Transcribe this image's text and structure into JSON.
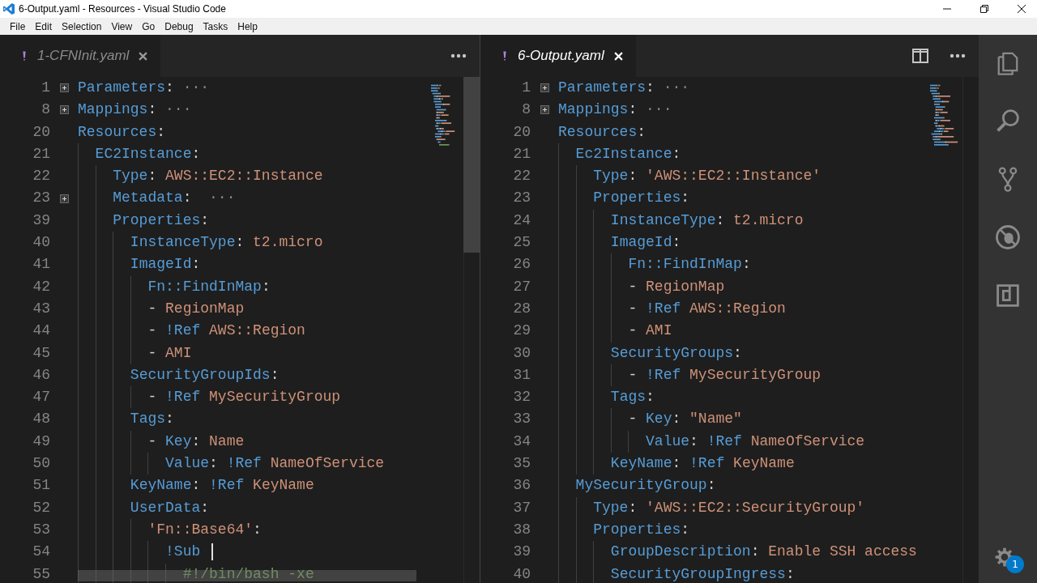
{
  "window": {
    "title": "6-Output.yaml - Resources - Visual Studio Code"
  },
  "menu": [
    "File",
    "Edit",
    "Selection",
    "View",
    "Go",
    "Debug",
    "Tasks",
    "Help"
  ],
  "editor_groups": [
    {
      "focused": false,
      "tab": {
        "label": "1-CFNInit.yaml"
      },
      "lines": [
        {
          "num": "1",
          "folded": true,
          "tokens": [
            {
              "t": "Parameters",
              "kind": "key"
            },
            {
              "t": ":",
              "kind": "punct"
            },
            {
              "t": " ···",
              "kind": "dots"
            }
          ]
        },
        {
          "num": "8",
          "folded": true,
          "tokens": [
            {
              "t": "Mappings",
              "kind": "key"
            },
            {
              "t": ":",
              "kind": "punct"
            },
            {
              "t": " ···",
              "kind": "dots"
            }
          ]
        },
        {
          "num": "20",
          "tokens": [
            {
              "t": "Resources",
              "kind": "key"
            },
            {
              "t": ":",
              "kind": "punct"
            }
          ]
        },
        {
          "num": "21",
          "tokens": [
            {
              "t": "  EC2Instance",
              "kind": "key"
            },
            {
              "t": ":",
              "kind": "punct"
            }
          ]
        },
        {
          "num": "22",
          "tokens": [
            {
              "t": "    Type",
              "kind": "key"
            },
            {
              "t": ": ",
              "kind": "punct"
            },
            {
              "t": "AWS::EC2::Instance",
              "kind": "str"
            }
          ]
        },
        {
          "num": "23",
          "folded": true,
          "tokens": [
            {
              "t": "    Metadata",
              "kind": "key"
            },
            {
              "t": ": ",
              "kind": "punct"
            },
            {
              "t": " ···",
              "kind": "dots"
            }
          ]
        },
        {
          "num": "39",
          "tokens": [
            {
              "t": "    Properties",
              "kind": "key"
            },
            {
              "t": ":",
              "kind": "punct"
            }
          ]
        },
        {
          "num": "40",
          "tokens": [
            {
              "t": "      InstanceType",
              "kind": "key"
            },
            {
              "t": ": ",
              "kind": "punct"
            },
            {
              "t": "t2.micro",
              "kind": "str"
            }
          ]
        },
        {
          "num": "41",
          "tokens": [
            {
              "t": "      ImageId",
              "kind": "key"
            },
            {
              "t": ":",
              "kind": "punct"
            }
          ]
        },
        {
          "num": "42",
          "tokens": [
            {
              "t": "        Fn::FindInMap",
              "kind": "key"
            },
            {
              "t": ":",
              "kind": "punct"
            }
          ]
        },
        {
          "num": "43",
          "tokens": [
            {
              "t": "        - ",
              "kind": "punct"
            },
            {
              "t": "RegionMap",
              "kind": "str"
            }
          ]
        },
        {
          "num": "44",
          "tokens": [
            {
              "t": "        - ",
              "kind": "punct"
            },
            {
              "t": "!Ref",
              "kind": "tag"
            },
            {
              "t": " AWS::Region",
              "kind": "str"
            }
          ]
        },
        {
          "num": "45",
          "tokens": [
            {
              "t": "        - ",
              "kind": "punct"
            },
            {
              "t": "AMI",
              "kind": "str"
            }
          ]
        },
        {
          "num": "46",
          "tokens": [
            {
              "t": "      SecurityGroupIds",
              "kind": "key"
            },
            {
              "t": ":",
              "kind": "punct"
            }
          ]
        },
        {
          "num": "47",
          "tokens": [
            {
              "t": "        - ",
              "kind": "punct"
            },
            {
              "t": "!Ref",
              "kind": "tag"
            },
            {
              "t": " MySecurityGroup",
              "kind": "str"
            }
          ]
        },
        {
          "num": "48",
          "tokens": [
            {
              "t": "      Tags",
              "kind": "key"
            },
            {
              "t": ":",
              "kind": "punct"
            }
          ]
        },
        {
          "num": "49",
          "tokens": [
            {
              "t": "        - ",
              "kind": "punct"
            },
            {
              "t": "Key",
              "kind": "key"
            },
            {
              "t": ": ",
              "kind": "punct"
            },
            {
              "t": "Name",
              "kind": "str"
            }
          ]
        },
        {
          "num": "50",
          "tokens": [
            {
              "t": "          Value",
              "kind": "key"
            },
            {
              "t": ": ",
              "kind": "punct"
            },
            {
              "t": "!Ref",
              "kind": "tag"
            },
            {
              "t": " NameOfService",
              "kind": "str"
            }
          ]
        },
        {
          "num": "51",
          "tokens": [
            {
              "t": "      KeyName",
              "kind": "key"
            },
            {
              "t": ": ",
              "kind": "punct"
            },
            {
              "t": "!Ref",
              "kind": "tag"
            },
            {
              "t": " KeyName",
              "kind": "str"
            }
          ]
        },
        {
          "num": "52",
          "tokens": [
            {
              "t": "      UserData",
              "kind": "key"
            },
            {
              "t": ":",
              "kind": "punct"
            }
          ]
        },
        {
          "num": "53",
          "tokens": [
            {
              "t": "        'Fn::Base64'",
              "kind": "str"
            },
            {
              "t": ":",
              "kind": "punct"
            }
          ]
        },
        {
          "num": "54",
          "cursor": true,
          "tokens": [
            {
              "t": "          !Sub",
              "kind": "tag"
            }
          ]
        },
        {
          "num": "55",
          "tokens": [
            {
              "t": "            #!/bin/bash -xe",
              "kind": "comment"
            }
          ]
        }
      ]
    },
    {
      "focused": true,
      "tab": {
        "label": "6-Output.yaml"
      },
      "lines": [
        {
          "num": "1",
          "folded": true,
          "tokens": [
            {
              "t": "Parameters",
              "kind": "key"
            },
            {
              "t": ":",
              "kind": "punct"
            },
            {
              "t": " ···",
              "kind": "dots"
            }
          ]
        },
        {
          "num": "8",
          "folded": true,
          "tokens": [
            {
              "t": "Mappings",
              "kind": "key"
            },
            {
              "t": ":",
              "kind": "punct"
            },
            {
              "t": " ···",
              "kind": "dots"
            }
          ]
        },
        {
          "num": "20",
          "tokens": [
            {
              "t": "Resources",
              "kind": "key"
            },
            {
              "t": ":",
              "kind": "punct"
            }
          ]
        },
        {
          "num": "21",
          "tokens": [
            {
              "t": "  Ec2Instance",
              "kind": "key"
            },
            {
              "t": ":",
              "kind": "punct"
            }
          ]
        },
        {
          "num": "22",
          "tokens": [
            {
              "t": "    Type",
              "kind": "key"
            },
            {
              "t": ": ",
              "kind": "punct"
            },
            {
              "t": "'AWS::EC2::Instance'",
              "kind": "str"
            }
          ]
        },
        {
          "num": "23",
          "tokens": [
            {
              "t": "    Properties",
              "kind": "key"
            },
            {
              "t": ":",
              "kind": "punct"
            }
          ]
        },
        {
          "num": "24",
          "tokens": [
            {
              "t": "      InstanceType",
              "kind": "key"
            },
            {
              "t": ": ",
              "kind": "punct"
            },
            {
              "t": "t2.micro",
              "kind": "str"
            }
          ]
        },
        {
          "num": "25",
          "tokens": [
            {
              "t": "      ImageId",
              "kind": "key"
            },
            {
              "t": ":",
              "kind": "punct"
            }
          ]
        },
        {
          "num": "26",
          "tokens": [
            {
              "t": "        Fn::FindInMap",
              "kind": "key"
            },
            {
              "t": ":",
              "kind": "punct"
            }
          ]
        },
        {
          "num": "27",
          "tokens": [
            {
              "t": "        - ",
              "kind": "punct"
            },
            {
              "t": "RegionMap",
              "kind": "str"
            }
          ]
        },
        {
          "num": "28",
          "tokens": [
            {
              "t": "        - ",
              "kind": "punct"
            },
            {
              "t": "!Ref",
              "kind": "tag"
            },
            {
              "t": " AWS::Region",
              "kind": "str"
            }
          ]
        },
        {
          "num": "29",
          "tokens": [
            {
              "t": "        - ",
              "kind": "punct"
            },
            {
              "t": "AMI",
              "kind": "str"
            }
          ]
        },
        {
          "num": "30",
          "tokens": [
            {
              "t": "      SecurityGroups",
              "kind": "key"
            },
            {
              "t": ":",
              "kind": "punct"
            }
          ]
        },
        {
          "num": "31",
          "tokens": [
            {
              "t": "        - ",
              "kind": "punct"
            },
            {
              "t": "!Ref",
              "kind": "tag"
            },
            {
              "t": " MySecurityGroup",
              "kind": "str"
            }
          ]
        },
        {
          "num": "32",
          "tokens": [
            {
              "t": "      Tags",
              "kind": "key"
            },
            {
              "t": ":",
              "kind": "punct"
            }
          ]
        },
        {
          "num": "33",
          "tokens": [
            {
              "t": "        - ",
              "kind": "punct"
            },
            {
              "t": "Key",
              "kind": "key"
            },
            {
              "t": ": ",
              "kind": "punct"
            },
            {
              "t": "\"Name\"",
              "kind": "str"
            }
          ]
        },
        {
          "num": "34",
          "tokens": [
            {
              "t": "          Value",
              "kind": "key"
            },
            {
              "t": ": ",
              "kind": "punct"
            },
            {
              "t": "!Ref",
              "kind": "tag"
            },
            {
              "t": " NameOfService",
              "kind": "str"
            }
          ]
        },
        {
          "num": "35",
          "tokens": [
            {
              "t": "      KeyName",
              "kind": "key"
            },
            {
              "t": ": ",
              "kind": "punct"
            },
            {
              "t": "!Ref",
              "kind": "tag"
            },
            {
              "t": " KeyName",
              "kind": "str"
            }
          ]
        },
        {
          "num": "36",
          "tokens": [
            {
              "t": "  MySecurityGroup",
              "kind": "key"
            },
            {
              "t": ":",
              "kind": "punct"
            }
          ]
        },
        {
          "num": "37",
          "tokens": [
            {
              "t": "    Type",
              "kind": "key"
            },
            {
              "t": ": ",
              "kind": "punct"
            },
            {
              "t": "'AWS::EC2::SecurityGroup'",
              "kind": "str"
            }
          ]
        },
        {
          "num": "38",
          "tokens": [
            {
              "t": "    Properties",
              "kind": "key"
            },
            {
              "t": ":",
              "kind": "punct"
            }
          ]
        },
        {
          "num": "39",
          "tokens": [
            {
              "t": "      GroupDescription",
              "kind": "key"
            },
            {
              "t": ": ",
              "kind": "punct"
            },
            {
              "t": "Enable SSH access",
              "kind": "str"
            }
          ]
        },
        {
          "num": "40",
          "tokens": [
            {
              "t": "      SecurityGroupIngress",
              "kind": "key"
            },
            {
              "t": ":",
              "kind": "punct"
            }
          ]
        }
      ]
    }
  ],
  "activity_bar": {
    "settings_badge": "1"
  }
}
